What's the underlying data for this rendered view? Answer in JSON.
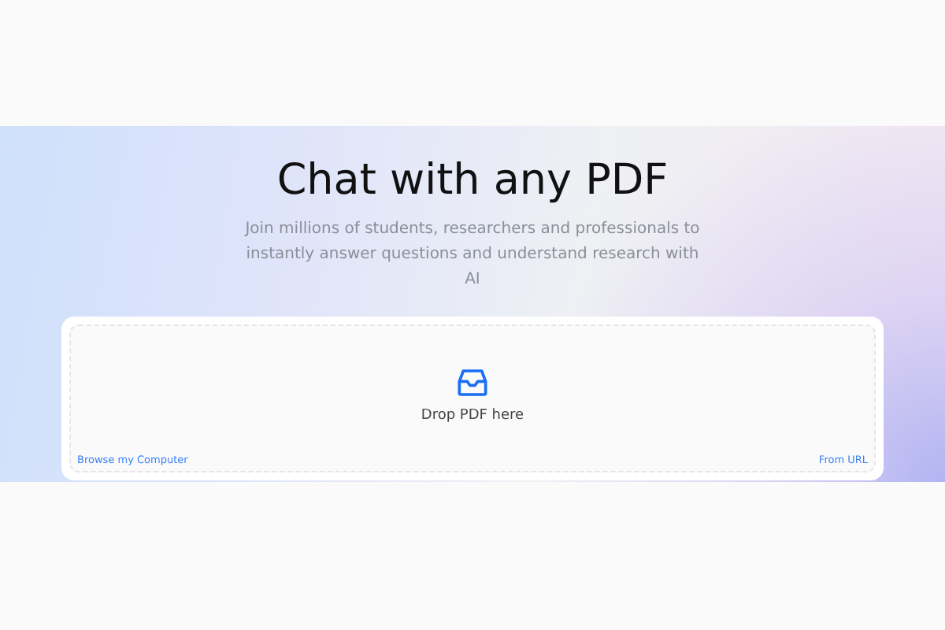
{
  "hero": {
    "title": "Chat with any PDF",
    "subtitle": "Join millions of students, researchers and professionals to instantly answer questions and understand research with AI"
  },
  "upload": {
    "prompt": "Drop PDF here",
    "links": [
      "Browse my Computer",
      "From URL"
    ]
  }
}
